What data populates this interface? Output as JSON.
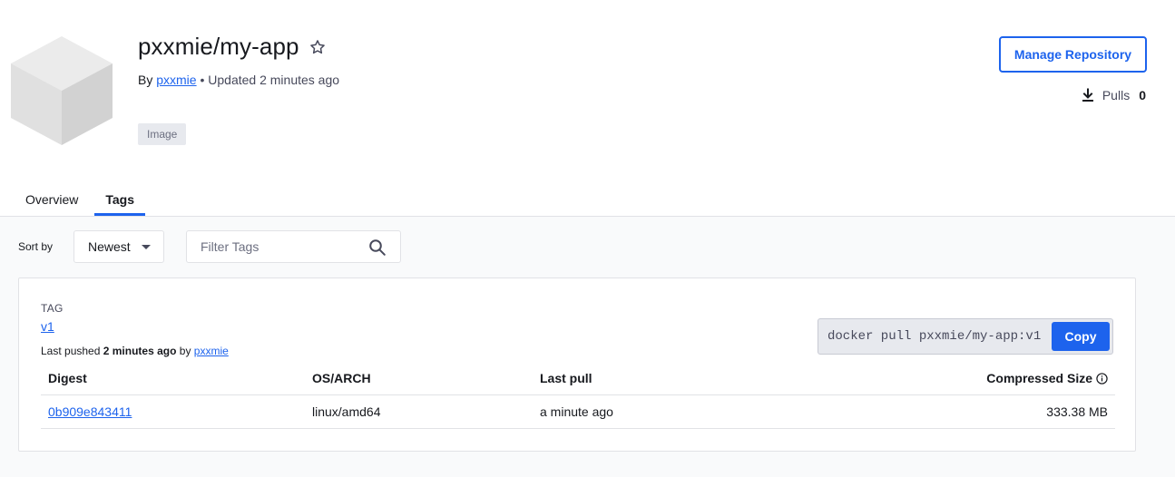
{
  "repo": {
    "name": "pxxmie/my-app",
    "by_prefix": "By",
    "owner": "pxxmie",
    "updated": "• Updated 2 minutes ago",
    "badge": "Image"
  },
  "actions": {
    "manage_label": "Manage Repository",
    "pulls_label": "Pulls",
    "pulls_count": "0"
  },
  "tabs": [
    {
      "label": "Overview",
      "active": false
    },
    {
      "label": "Tags",
      "active": true
    }
  ],
  "filters": {
    "sort_label": "Sort by",
    "sort_value": "Newest",
    "filter_placeholder": "Filter Tags"
  },
  "tag_card": {
    "tag_heading": "TAG",
    "tag_name": "v1",
    "pushed_prefix": "Last pushed",
    "pushed_time": "2 minutes ago",
    "pushed_by": "by",
    "pushed_user": "pxxmie",
    "pull_command": "docker pull pxxmie/my-app:v1",
    "copy_label": "Copy",
    "columns": [
      "Digest",
      "OS/ARCH",
      "Last pull",
      "Compressed Size"
    ],
    "rows": [
      {
        "digest": "0b909e843411",
        "os_arch": "linux/amd64",
        "last_pull": "a minute ago",
        "size": "333.38 MB"
      }
    ]
  },
  "icons": {
    "star": "star-icon",
    "download": "download-icon",
    "search": "search-icon",
    "info": "info-icon",
    "caret": "caret-down-icon"
  },
  "colors": {
    "accent": "#1d63ed",
    "text": "#17191e",
    "muted": "#47495b",
    "background": "#f9fafb"
  }
}
